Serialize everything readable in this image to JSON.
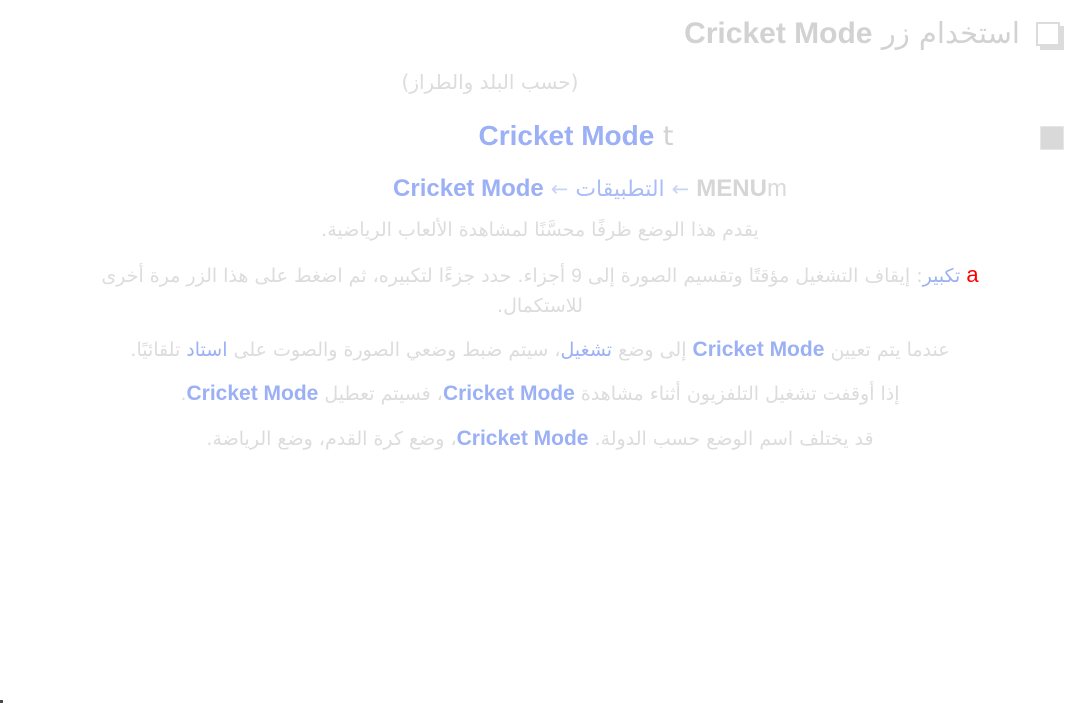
{
  "document": {
    "language": "ar",
    "direction": "rtl",
    "background_color": "#ffffff"
  },
  "colors": {
    "heading_grey": "#d2d2d2",
    "body_grey": "#dcdcdc",
    "link_blue": "#9bb0f5",
    "arrow_blue": "#c9d4f7",
    "key_red": "#ff0000",
    "bullet_fill": "#d9d9d9"
  },
  "heading": {
    "bullet_icon": "layered-square-icon",
    "text_ar": "استخدام زر",
    "text_latin": "Cricket Mode",
    "full": "استخدام زر Cricket Mode",
    "subtitle": "(حسب البلد والطراز)"
  },
  "section": {
    "bullet_icon": "filled-square-icon",
    "title_latin": "Cricket Mode",
    "title_suffix": "t",
    "full": "Cricket Mode t"
  },
  "nav_path": {
    "menu_key": "MENU",
    "menu_key_suffix": "m",
    "arrow": "←",
    "step_apps": "التطبيقات",
    "step_mode": "Cricket Mode",
    "full": "MENUm ← التطبيقات ← Cricket Mode"
  },
  "paragraphs": {
    "intro": "يقدم هذا الوضع ظرفًا محسَّنًا لمشاهدة الألعاب الرياضية.",
    "zoom": {
      "key_label": "a",
      "term": "تكبير",
      "colon": ":",
      "text_part1": "إيقاف التشغيل مؤقتًا وتقسيم الصورة إلى",
      "number": "9",
      "text_part2": "أجزاء. حدد جزءًا لتكبيره، ثم اضغط على هذا الزر مرة أخرى للاستكمال.",
      "full": "a تكبير: إيقاف التشغيل مؤقتًا وتقسيم الصورة إلى 9 أجزاء. حدد جزءًا لتكبيره، ثم اضغط على هذا الزر مرة أخرى للاستكمال."
    },
    "auto_mode": {
      "text_part1": "عندما يتم تعيين",
      "term_mode": "Cricket Mode",
      "text_part2": "إلى وضع",
      "term_on": "تشغيل",
      "text_part3": "، سيتم ضبط وضعي الصورة والصوت على",
      "term_stadium": "استاد",
      "text_part4": "تلقائيًا.",
      "full": "عندما يتم تعيين Cricket Mode إلى وضع تشغيل، سيتم ضبط وضعي الصورة والصوت على استاد تلقائيًا."
    },
    "turn_off": {
      "text_part1": "إذا أوقفت تشغيل التلفزيون أثناء مشاهدة",
      "term_mode1": "Cricket Mode",
      "text_part2": "، فسيتم تعطيل",
      "term_mode2": "Cricket Mode",
      "period": ".",
      "full": "إذا أوقفت تشغيل التلفزيون أثناء مشاهدة Cricket Mode، فسيتم تعطيل Cricket Mode."
    },
    "naming": {
      "text_part1": "قد يختلف اسم الوضع حسب الدولة.",
      "term_mode": "Cricket Mode",
      "text_part2": "، وضع كرة القدم، وضع الرياضة.",
      "full": "قد يختلف اسم الوضع حسب الدولة. Cricket Mode، وضع كرة القدم، وضع الرياضة."
    }
  }
}
